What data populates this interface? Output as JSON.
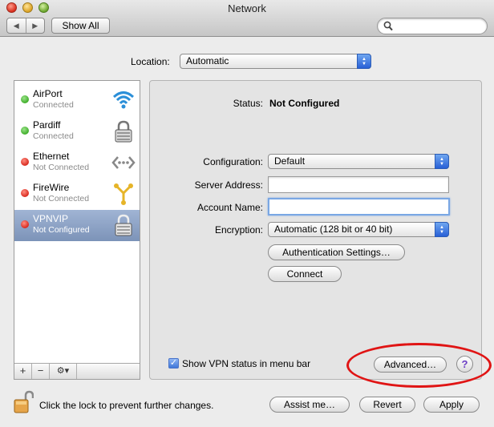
{
  "window": {
    "title": "Network"
  },
  "toolbar": {
    "back_glyph": "◀",
    "forward_glyph": "▶",
    "show_all_label": "Show All",
    "search_value": ""
  },
  "location": {
    "label": "Location:",
    "value": "Automatic"
  },
  "services": [
    {
      "name": "AirPort",
      "status": "Connected",
      "dot_color": "#3fae2a",
      "icon": "wifi-icon"
    },
    {
      "name": "Pardiff",
      "status": "Connected",
      "dot_color": "#3fae2a",
      "icon": "vpn-lock-icon"
    },
    {
      "name": "Ethernet",
      "status": "Not Connected",
      "dot_color": "#d92a1f",
      "icon": "ethernet-icon"
    },
    {
      "name": "FireWire",
      "status": "Not Connected",
      "dot_color": "#d92a1f",
      "icon": "firewire-icon"
    },
    {
      "name": "VPNVIP",
      "status": "Not Configured",
      "dot_color": "#d92a1f",
      "icon": "vpn-lock-icon",
      "selected": true
    }
  ],
  "sidebar_controls": {
    "add": "+",
    "remove": "−",
    "action": "⚙▾"
  },
  "detail": {
    "status_label": "Status:",
    "status_value": "Not Configured",
    "configuration_label": "Configuration:",
    "configuration_value": "Default",
    "server_address_label": "Server Address:",
    "server_address_value": "",
    "account_name_label": "Account Name:",
    "account_name_value": "",
    "encryption_label": "Encryption:",
    "encryption_value": "Automatic (128 bit or 40 bit)",
    "auth_settings_label": "Authentication Settings…",
    "connect_label": "Connect",
    "show_vpn_status_label": "Show VPN status in menu bar",
    "show_vpn_status_checked": true,
    "advanced_label": "Advanced…",
    "help_label": "?"
  },
  "footer": {
    "lock_text": "Click the lock to prevent further changes.",
    "assist_label": "Assist me…",
    "revert_label": "Revert",
    "apply_label": "Apply"
  },
  "colors": {
    "selection": "#7c93b8",
    "accent_blue": "#2860d6",
    "annotation_red": "#e01414"
  }
}
